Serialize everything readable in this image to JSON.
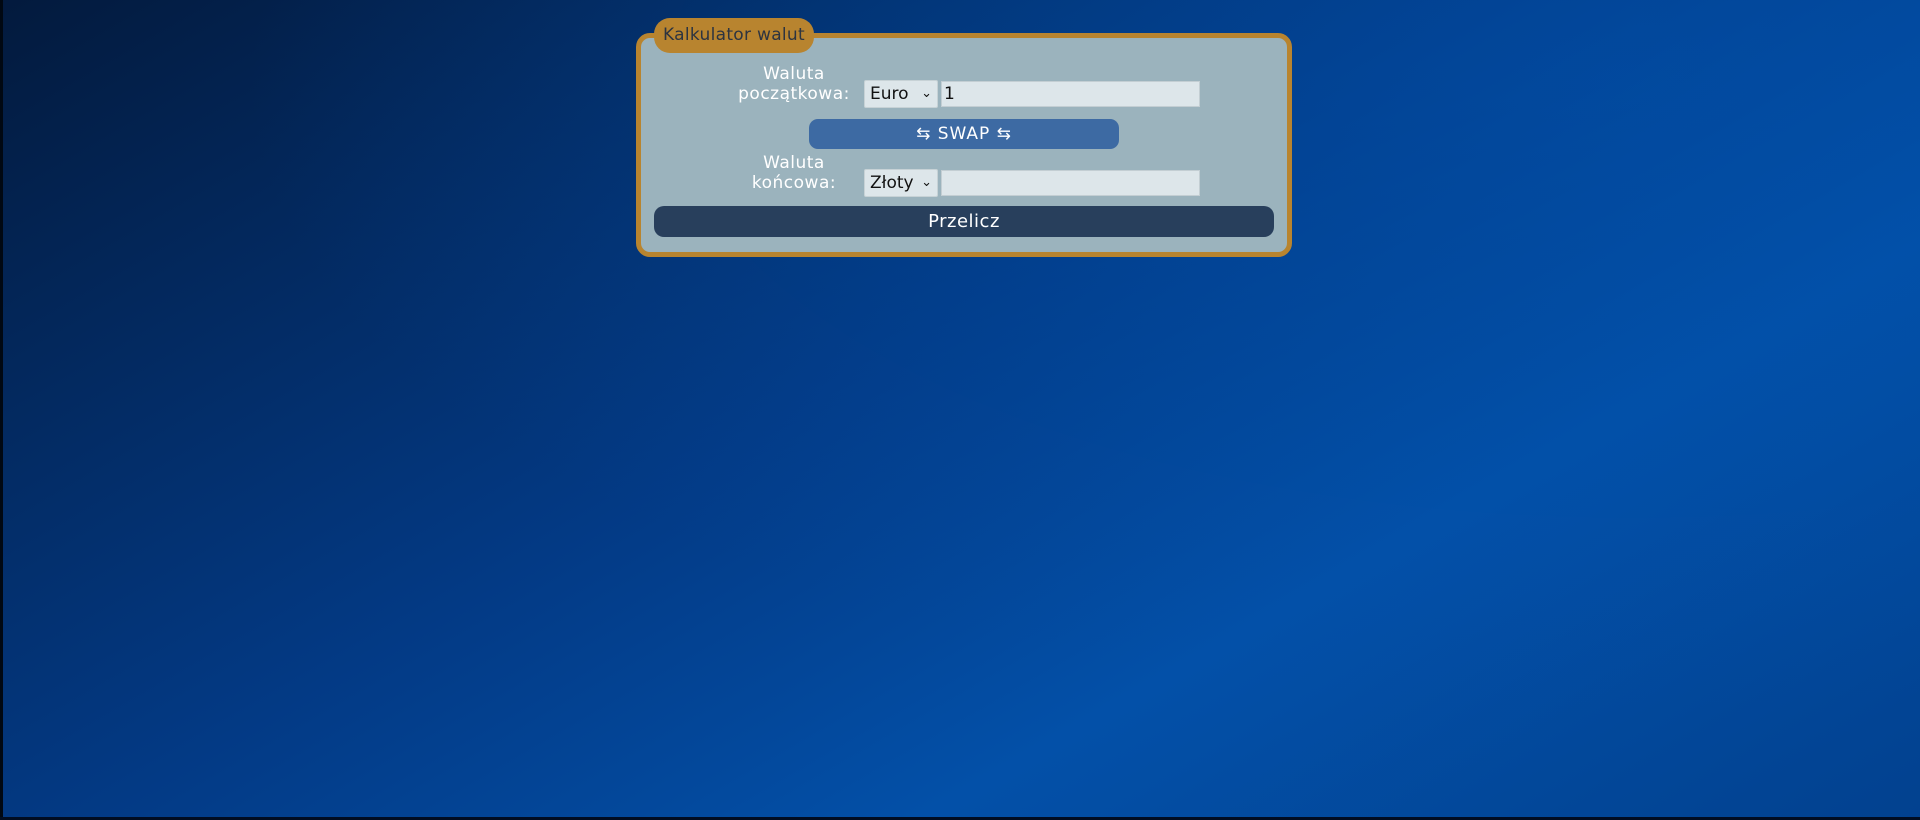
{
  "app": {
    "title": "Kalkulator walut"
  },
  "from": {
    "label": "Waluta początkowa:",
    "currency": "Euro",
    "amount": "1"
  },
  "swap": {
    "label": "⇆ SWAP ⇆"
  },
  "to": {
    "label": "Waluta końcowa:",
    "currency": "Złoty",
    "amount": ""
  },
  "actions": {
    "convert_label": "Przelicz"
  },
  "icons": {
    "dropdown": "chevron-down-icon"
  },
  "colors": {
    "panel_background": "#9bb3bd",
    "panel_border": "#b8842f",
    "swap_button": "#3d6aa3",
    "convert_button": "#283f5c",
    "page_background": "#0350a8"
  }
}
